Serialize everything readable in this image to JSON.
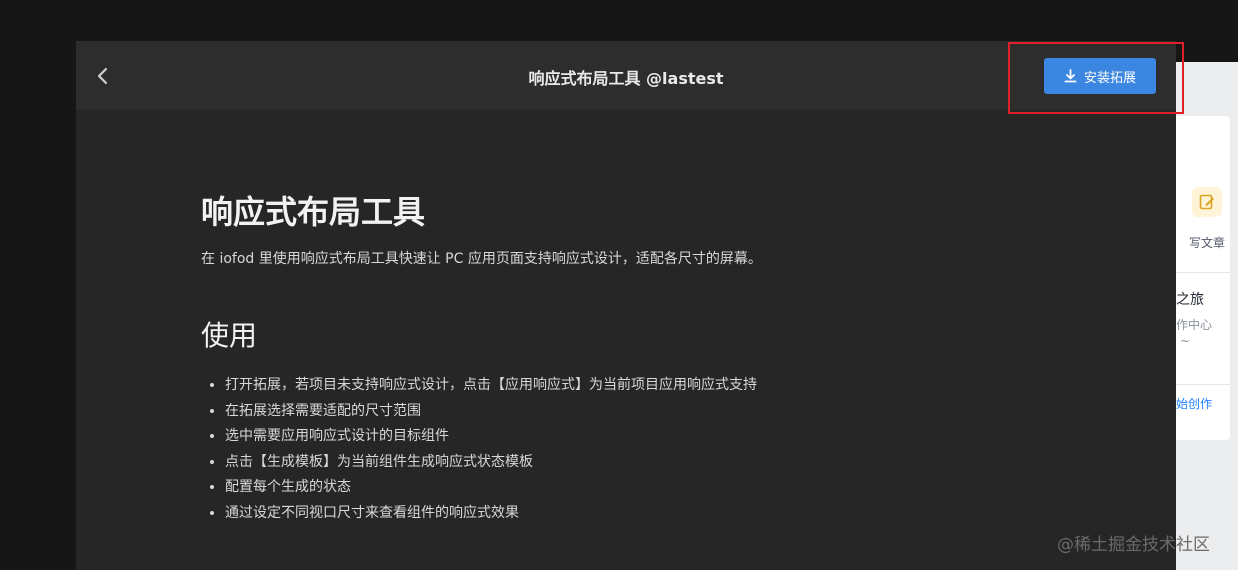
{
  "background_page": {
    "write_article": "写文章",
    "journey_fragment": "之旅",
    "center_fragment": "作中心",
    "dash_fragment": "~",
    "start_fragment": "始创作"
  },
  "modal": {
    "title": "响应式布局工具 @lastest",
    "install_label": "安装拓展",
    "icons": {
      "back": "chevron-left-icon",
      "install": "download-icon"
    }
  },
  "content": {
    "heading": "响应式布局工具",
    "description": "在 iofod 里使用响应式布局工具快速让 PC 应用页面支持响应式设计，适配各尺寸的屏幕。",
    "usage_heading": "使用",
    "usage_steps": [
      "打开拓展，若项目未支持响应式设计，点击【应用响应式】为当前项目应用响应式支持",
      "在拓展选择需要适配的尺寸范围",
      "选中需要应用响应式设计的目标组件",
      "点击【生成模板】为当前组件生成响应式状态模板",
      "配置每个生成的状态",
      "通过设定不同视口尺寸来查看组件的响应式效果"
    ]
  },
  "watermark": "@稀土掘金技术社区",
  "colors": {
    "accent": "#3b86e0",
    "highlight": "#e02027",
    "modal_bg": "#262626",
    "header_bg": "#2d2d2d"
  }
}
